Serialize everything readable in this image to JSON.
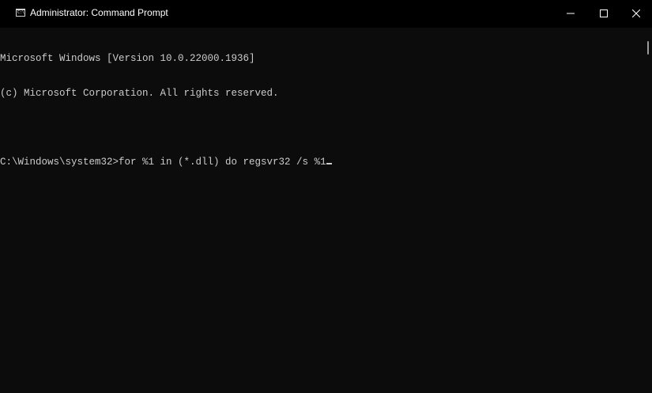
{
  "window": {
    "title": "Administrator: Command Prompt"
  },
  "icons": {
    "app": "command-prompt-icon",
    "minimize": "minimize-icon",
    "maximize": "maximize-icon",
    "close": "close-icon"
  },
  "console": {
    "lines": [
      "Microsoft Windows [Version 10.0.22000.1936]",
      "(c) Microsoft Corporation. All rights reserved.",
      "",
      "C:\\Windows\\system32>for %1 in (*.dll) do regsvr32 /s %1"
    ]
  },
  "colors": {
    "background": "#0c0c0c",
    "titlebar": "#000000",
    "text": "#cccccc"
  }
}
